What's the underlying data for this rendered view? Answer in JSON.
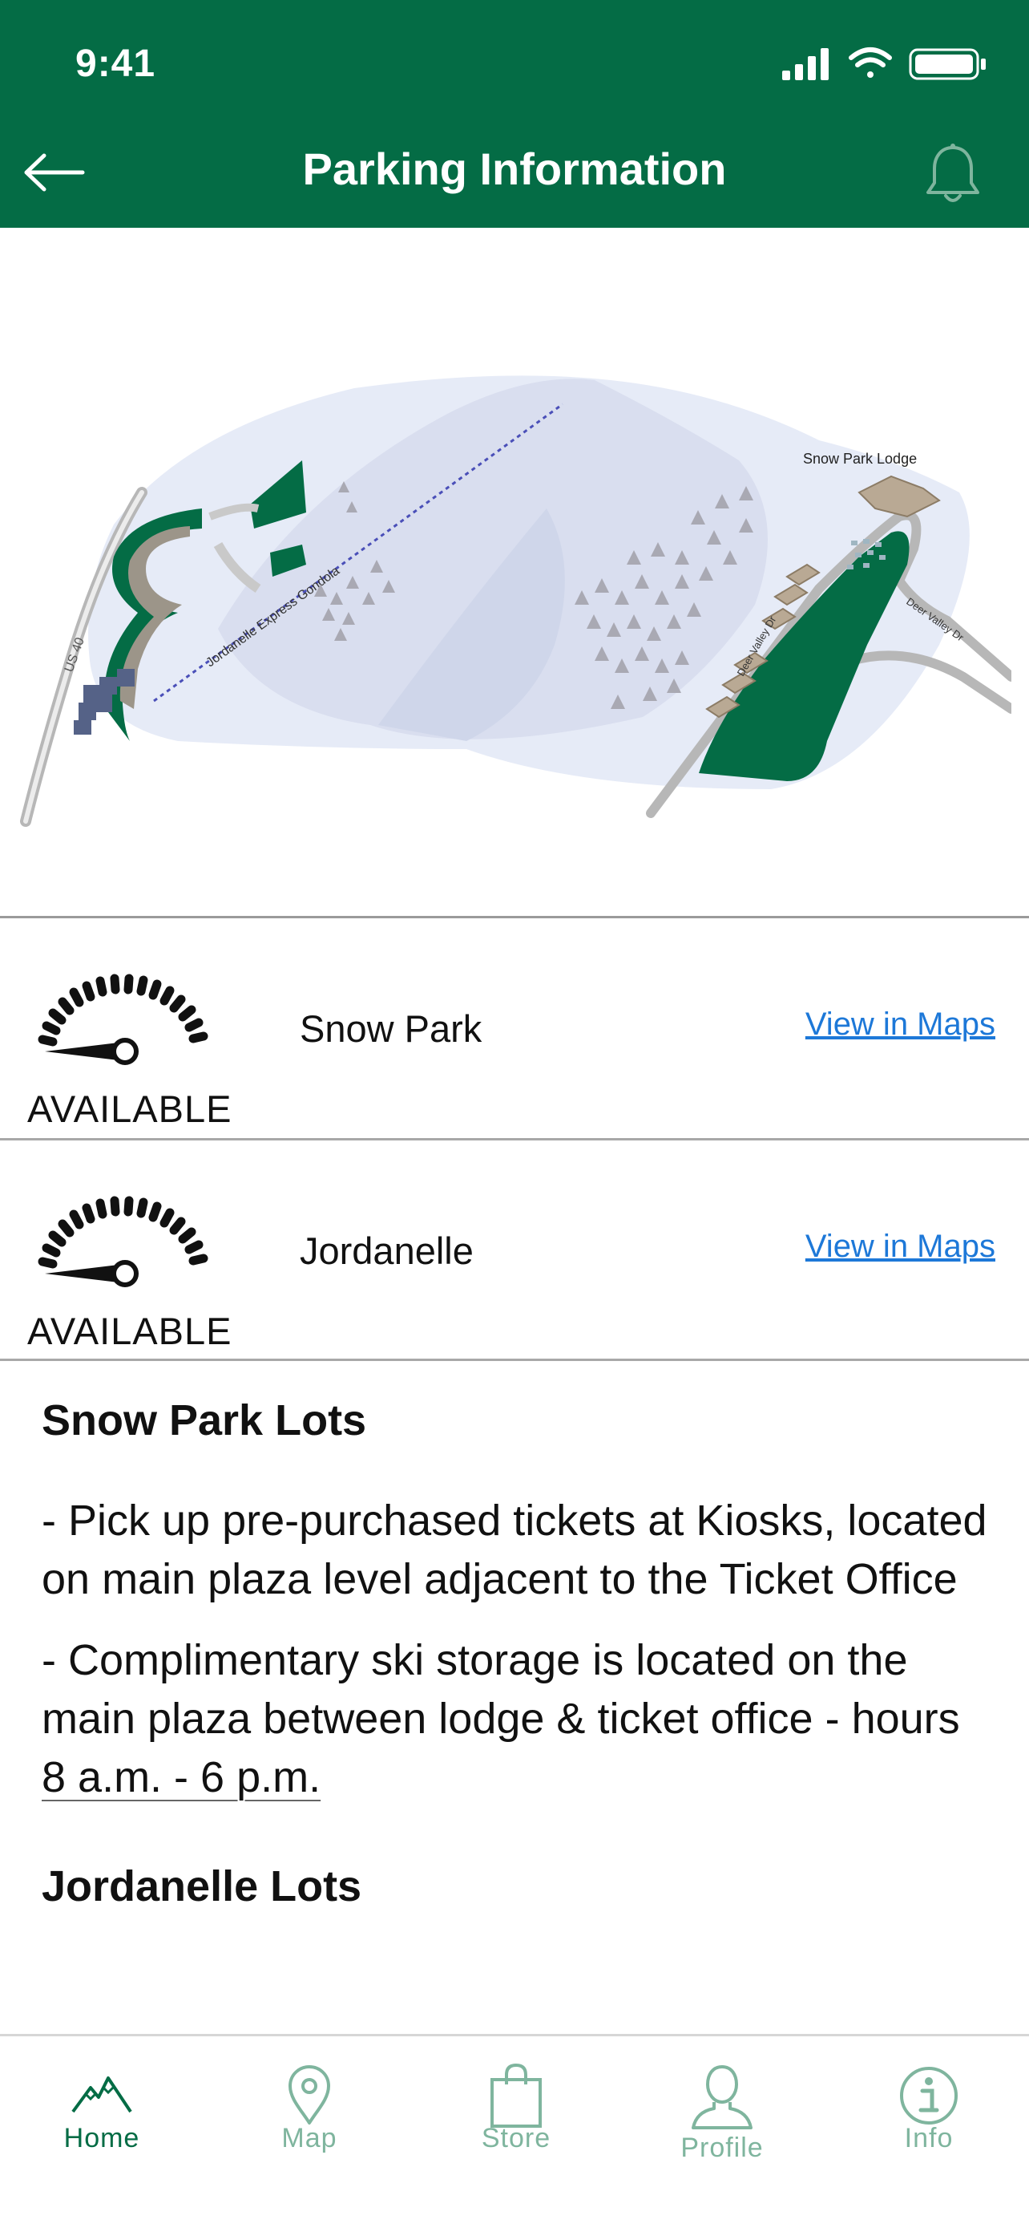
{
  "status_bar": {
    "time": "9:41"
  },
  "nav": {
    "title": "Parking Information"
  },
  "map": {
    "labels": {
      "lodge": "Snow Park Lodge",
      "gondola": "Jordanelle Express Gondola",
      "highway": "US 40",
      "road_1": "Deer Valley Dr",
      "road_2": "Deer Valley Dr"
    }
  },
  "lots": [
    {
      "name": "Snow Park",
      "status": "AVAILABLE",
      "link": "View in Maps"
    },
    {
      "name": "Jordanelle",
      "status": "AVAILABLE",
      "link": "View in Maps"
    }
  ],
  "info": {
    "snow_park_heading": "Snow Park Lots",
    "para_1": "- Pick up pre-purchased tickets at Kiosks, located on main plaza level adjacent to the Ticket Office",
    "para_2_prefix": "- Complimentary ski storage is located on the main plaza between lodge & ticket office - hours ",
    "para_2_hours": "8 a.m. - 6 p.m.",
    "jordanelle_heading": "Jordanelle Lots"
  },
  "tabs": [
    {
      "label": "Home",
      "icon": "mountain-icon",
      "active": true
    },
    {
      "label": "Map",
      "icon": "map-pin-icon",
      "active": false
    },
    {
      "label": "Store",
      "icon": "shopping-bag-icon",
      "active": false
    },
    {
      "label": "Profile",
      "icon": "person-icon",
      "active": false
    },
    {
      "label": "Info",
      "icon": "info-icon",
      "active": false
    }
  ],
  "colors": {
    "brand_green": "#046c45",
    "link_blue": "#1d78d8",
    "tab_inactive": "#7fb59e"
  }
}
